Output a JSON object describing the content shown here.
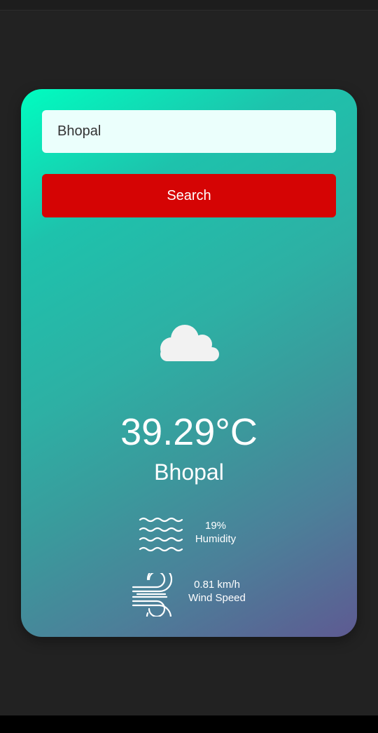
{
  "search": {
    "value": "Bhopal",
    "button_label": "Search"
  },
  "weather": {
    "icon": "cloud-icon",
    "temperature": "39.29°C",
    "city": "Bhopal"
  },
  "details": {
    "humidity": {
      "icon": "humidity-waves-icon",
      "value": "19%",
      "label": "Humidity"
    },
    "wind": {
      "icon": "wind-icon",
      "value": "0.81 km/h",
      "label": "Wind Speed"
    }
  },
  "colors": {
    "card_gradient_start": "#00fdc0",
    "card_gradient_end": "#5e5a92",
    "search_button": "#d50404",
    "input_background": "#ebfffc",
    "page_background": "#222222"
  }
}
